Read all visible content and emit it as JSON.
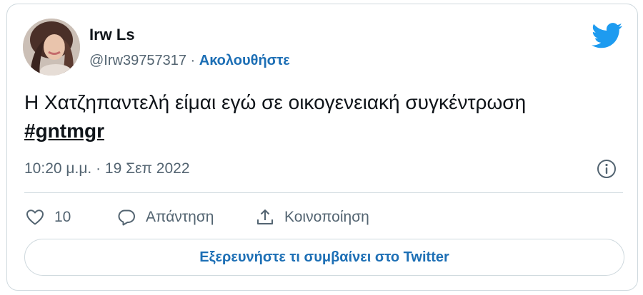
{
  "tweet": {
    "author": {
      "name": "Irw Ls",
      "handle": "@Irw39757317",
      "separator": "·",
      "follow_label": "Ακολουθήστε"
    },
    "text": "Η Χατζηπαντελή είμαι εγώ σε οικογενειακή συγκέντρωση",
    "hashtag": "#gntmgr",
    "timestamp": "10:20 μ.μ. · 19 Σεπ 2022",
    "actions": {
      "like_count": "10",
      "reply_label": "Απάντηση",
      "share_label": "Κοινοποίηση"
    },
    "explore_label": "Εξερευνήστε τι συμβαίνει στο Twitter"
  },
  "icons": {
    "brand": "twitter-bird-icon",
    "info": "info-icon",
    "like": "heart-icon",
    "reply": "speech-bubble-icon",
    "share": "share-upload-icon"
  },
  "colors": {
    "twitter_blue": "#1d9bf0",
    "link_blue": "#1d6fb5",
    "secondary_text": "#536471",
    "border": "#cfd9de"
  }
}
